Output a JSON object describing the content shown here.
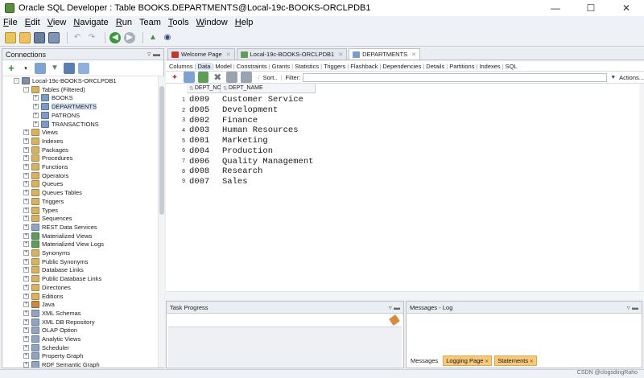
{
  "window": {
    "title": "Oracle SQL Developer : Table BOOKS.DEPARTMENTS@Local-19c-BOOKS-ORCLPDB1"
  },
  "menu": [
    {
      "u": "F",
      "rest": "ile"
    },
    {
      "u": "E",
      "rest": "dit"
    },
    {
      "u": "V",
      "rest": "iew"
    },
    {
      "u": "N",
      "rest": "avigate"
    },
    {
      "u": "R",
      "rest": "un"
    },
    {
      "u": "",
      "rest": "Team"
    },
    {
      "u": "T",
      "rest": "ools"
    },
    {
      "u": "W",
      "rest": "indow"
    },
    {
      "u": "H",
      "rest": "elp"
    }
  ],
  "connections": {
    "title": "Connections",
    "tree": [
      {
        "label": "Local-19c-BOOKS-ORCLPDB1",
        "level": 1,
        "exp": "-",
        "icon": "database-icon",
        "color": "#7f8fa6"
      },
      {
        "label": "Tables (Filtered)",
        "level": 2,
        "exp": "-",
        "icon": "folder-table-icon",
        "color": "#d9b25f"
      },
      {
        "label": "BOOKS",
        "level": 3,
        "exp": "+",
        "icon": "table-icon",
        "color": "#7b9cc8"
      },
      {
        "label": "DEPARTMENTS",
        "level": 3,
        "exp": "+",
        "icon": "table-icon",
        "color": "#7b9cc8",
        "selected": true
      },
      {
        "label": "PATRONS",
        "level": 3,
        "exp": "+",
        "icon": "table-icon",
        "color": "#7b9cc8"
      },
      {
        "label": "TRANSACTIONS",
        "level": 3,
        "exp": "+",
        "icon": "table-icon",
        "color": "#7b9cc8"
      },
      {
        "label": "Views",
        "level": 2,
        "exp": "+",
        "icon": "folder-icon",
        "color": "#d9b25f"
      },
      {
        "label": "Indexes",
        "level": 2,
        "exp": "+",
        "icon": "folder-icon",
        "color": "#d9b25f"
      },
      {
        "label": "Packages",
        "level": 2,
        "exp": "+",
        "icon": "folder-icon",
        "color": "#d9b25f"
      },
      {
        "label": "Procedures",
        "level": 2,
        "exp": "+",
        "icon": "folder-icon",
        "color": "#d9b25f"
      },
      {
        "label": "Functions",
        "level": 2,
        "exp": "+",
        "icon": "folder-icon",
        "color": "#d9b25f"
      },
      {
        "label": "Operators",
        "level": 2,
        "exp": "+",
        "icon": "folder-icon",
        "color": "#d9b25f"
      },
      {
        "label": "Queues",
        "level": 2,
        "exp": "+",
        "icon": "folder-icon",
        "color": "#d9b25f"
      },
      {
        "label": "Queues Tables",
        "level": 2,
        "exp": "+",
        "icon": "folder-icon",
        "color": "#d9b25f"
      },
      {
        "label": "Triggers",
        "level": 2,
        "exp": "+",
        "icon": "folder-icon",
        "color": "#d9b25f"
      },
      {
        "label": "Types",
        "level": 2,
        "exp": "+",
        "icon": "folder-icon",
        "color": "#d9b25f"
      },
      {
        "label": "Sequences",
        "level": 2,
        "exp": "+",
        "icon": "folder-icon",
        "color": "#d9b25f"
      },
      {
        "label": "REST Data Services",
        "level": 2,
        "exp": "+",
        "icon": "folder-icon",
        "color": "#8fa5c2"
      },
      {
        "label": "Materialized Views",
        "level": 2,
        "exp": "+",
        "icon": "folder-icon",
        "color": "#5e9e56"
      },
      {
        "label": "Materialized View Logs",
        "level": 2,
        "exp": "+",
        "icon": "folder-icon",
        "color": "#5e9e56"
      },
      {
        "label": "Synonyms",
        "level": 2,
        "exp": "+",
        "icon": "folder-icon",
        "color": "#d9b25f"
      },
      {
        "label": "Public Synonyms",
        "level": 2,
        "exp": "+",
        "icon": "folder-icon",
        "color": "#d9b25f"
      },
      {
        "label": "Database Links",
        "level": 2,
        "exp": "+",
        "icon": "folder-icon",
        "color": "#d9b25f"
      },
      {
        "label": "Public Database Links",
        "level": 2,
        "exp": "+",
        "icon": "folder-icon",
        "color": "#d9b25f"
      },
      {
        "label": "Directories",
        "level": 2,
        "exp": "+",
        "icon": "folder-icon",
        "color": "#d9b25f"
      },
      {
        "label": "Editions",
        "level": 2,
        "exp": "+",
        "icon": "folder-icon",
        "color": "#d9b25f"
      },
      {
        "label": "Java",
        "level": 2,
        "exp": "+",
        "icon": "folder-icon",
        "color": "#c98a3f"
      },
      {
        "label": "XML Schemas",
        "level": 2,
        "exp": "+",
        "icon": "folder-icon",
        "color": "#8fa5c2"
      },
      {
        "label": "XML DB Repository",
        "level": 2,
        "exp": "+",
        "icon": "folder-icon",
        "color": "#8fa5c2"
      },
      {
        "label": "OLAP Option",
        "level": 2,
        "exp": "+",
        "icon": "folder-icon",
        "color": "#8fa5c2"
      },
      {
        "label": "Analytic Views",
        "level": 2,
        "exp": "+",
        "icon": "folder-icon",
        "color": "#8fa5c2"
      },
      {
        "label": "Scheduler",
        "level": 2,
        "exp": "+",
        "icon": "folder-icon",
        "color": "#8fa5c2"
      },
      {
        "label": "Property Graph",
        "level": 2,
        "exp": "+",
        "icon": "folder-icon",
        "color": "#8fa5c2"
      },
      {
        "label": "RDF Semantic Graph",
        "level": 2,
        "exp": "+",
        "icon": "folder-icon",
        "color": "#8fa5c2"
      }
    ]
  },
  "doc_tabs": [
    {
      "label": "Welcome Page",
      "icon": "welcome-icon",
      "color": "#c0392b",
      "active": false
    },
    {
      "label": "Local-19c-BOOKS-ORCLPDB1",
      "icon": "sql-worksheet-icon",
      "color": "#5e9e56",
      "active": false
    },
    {
      "label": "DEPARTMENTS",
      "icon": "table-icon",
      "color": "#7b9cc8",
      "active": true
    }
  ],
  "sub_tabs": [
    {
      "label": "Columns",
      "active": false
    },
    {
      "label": "Data",
      "active": true
    },
    {
      "label": "Model",
      "active": false
    },
    {
      "label": "Constraints",
      "active": false
    },
    {
      "label": "Grants",
      "active": false
    },
    {
      "label": "Statistics",
      "active": false
    },
    {
      "label": "Triggers",
      "active": false
    },
    {
      "label": "Flashback",
      "active": false
    },
    {
      "label": "Dependencies",
      "active": false
    },
    {
      "label": "Details",
      "active": false
    },
    {
      "label": "Partitions",
      "active": false
    },
    {
      "label": "Indexes",
      "active": false
    },
    {
      "label": "SQL",
      "active": false
    }
  ],
  "gridbar": {
    "sort_label": "Sort..",
    "filter_label": "Filter:",
    "filter_value": "",
    "actions_label": "Actions..."
  },
  "grid": {
    "columns": [
      "DEPT_NO",
      "DEPT_NAME"
    ],
    "rows": [
      {
        "n": "1",
        "no": "d009",
        "name": "Customer Service"
      },
      {
        "n": "2",
        "no": "d005",
        "name": "Development"
      },
      {
        "n": "3",
        "no": "d002",
        "name": "Finance"
      },
      {
        "n": "4",
        "no": "d003",
        "name": "Human Resources"
      },
      {
        "n": "5",
        "no": "d001",
        "name": "Marketing"
      },
      {
        "n": "6",
        "no": "d004",
        "name": "Production"
      },
      {
        "n": "7",
        "no": "d006",
        "name": "Quality Management"
      },
      {
        "n": "8",
        "no": "d008",
        "name": "Research"
      },
      {
        "n": "9",
        "no": "d007",
        "name": "Sales"
      }
    ]
  },
  "task_progress": {
    "title": "Task Progress"
  },
  "messages": {
    "title": "Messages - Log",
    "tabs": [
      {
        "label": "Messages",
        "highlight": false,
        "closable": false
      },
      {
        "label": "Logging Page",
        "highlight": true,
        "closable": true
      },
      {
        "label": "Statements",
        "highlight": true,
        "closable": true
      }
    ]
  },
  "watermark": "CSDN @clogsdingRaho"
}
